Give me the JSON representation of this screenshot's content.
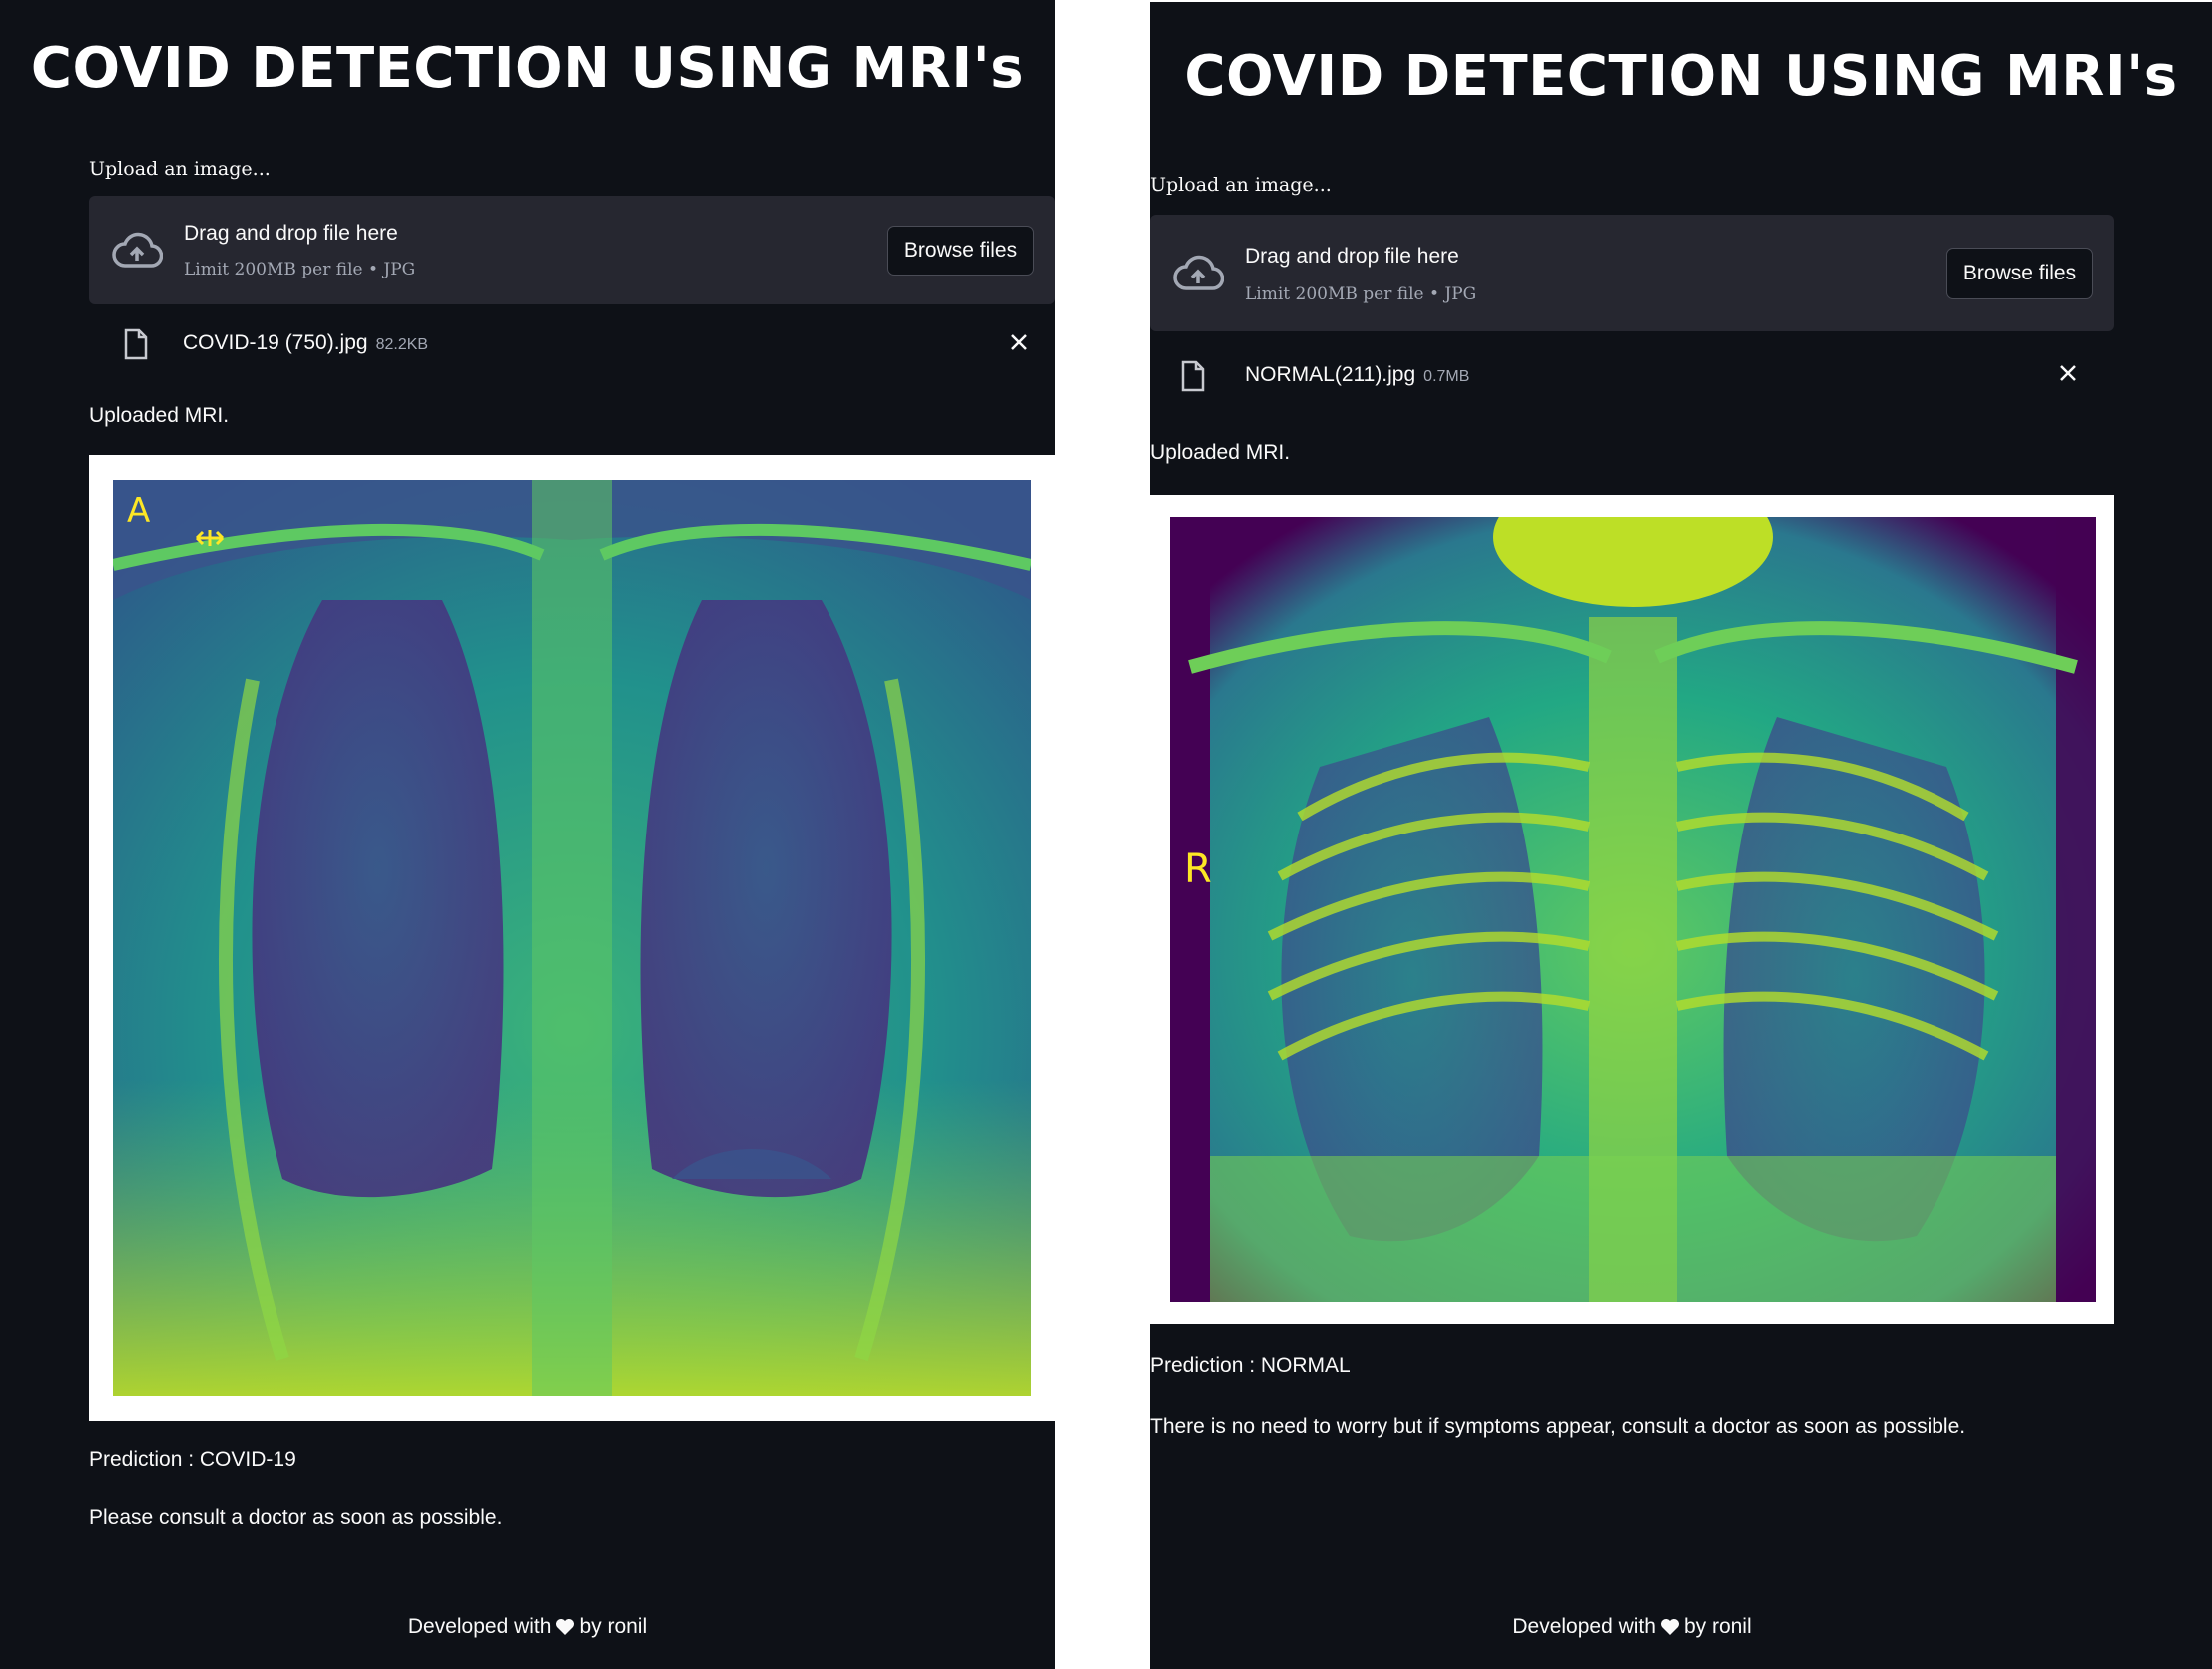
{
  "left": {
    "title": "COVID DETECTION USING MRI's",
    "upload_label": "Upload an image...",
    "uploader": {
      "drag_text": "Drag and drop file here",
      "limit_text": "Limit 200MB per file • JPG",
      "browse_label": "Browse files"
    },
    "file": {
      "name": "COVID-19 (750).jpg",
      "size": "82.2KB"
    },
    "uploaded_label": "Uploaded MRI.",
    "xray_marker": "A",
    "prediction": "Prediction : COVID-19",
    "message": "Please consult a doctor as soon as possible.",
    "footer": {
      "before": "Developed with",
      "after": "by ronil"
    }
  },
  "right": {
    "title": "COVID DETECTION USING MRI's",
    "upload_label": "Upload an image...",
    "uploader": {
      "drag_text": "Drag and drop file here",
      "limit_text": "Limit 200MB per file • JPG",
      "browse_label": "Browse files"
    },
    "file": {
      "name": "NORMAL(211).jpg",
      "size": "0.7MB"
    },
    "uploaded_label": "Uploaded MRI.",
    "xray_marker": "R",
    "prediction": "Prediction : NORMAL",
    "message": "There is no need to worry but if symptoms appear, consult a doctor as soon as possible.",
    "footer": {
      "before": "Developed with",
      "after": "by ronil"
    }
  },
  "colors": {
    "background": "#0e1117",
    "uploader_bg": "#262730",
    "text": "#fafafa",
    "muted": "#a3a8b4"
  },
  "icons": [
    "cloud-upload-icon",
    "file-icon",
    "close-icon",
    "heart-icon"
  ]
}
